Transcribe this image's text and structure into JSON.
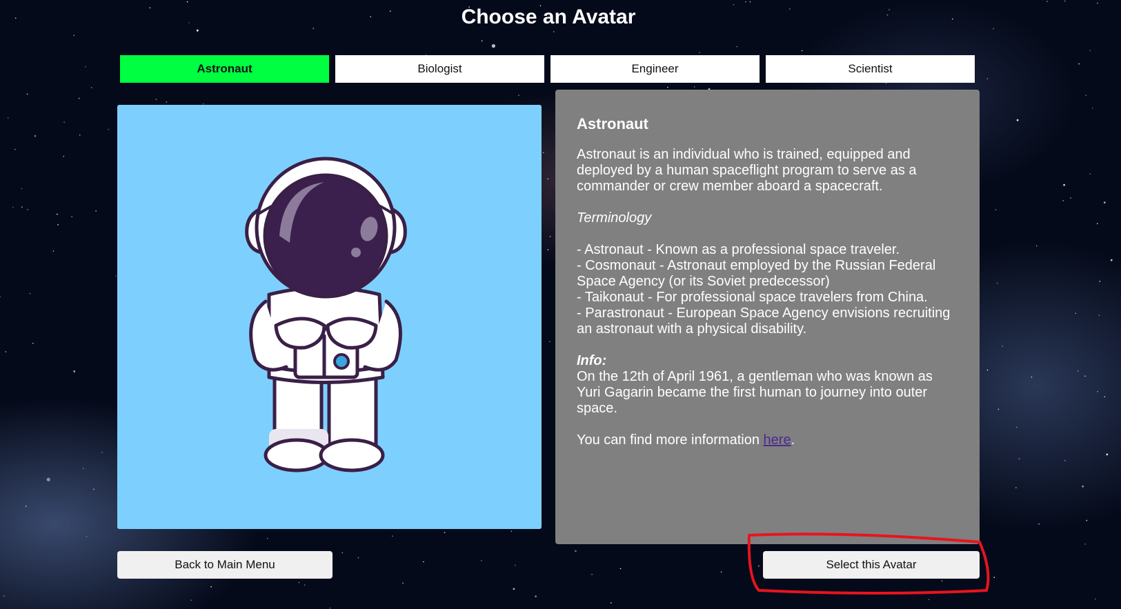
{
  "page": {
    "title": "Choose an Avatar"
  },
  "tabs": [
    {
      "label": "Astronaut",
      "active": true
    },
    {
      "label": "Biologist",
      "active": false
    },
    {
      "label": "Engineer",
      "active": false
    },
    {
      "label": "Scientist",
      "active": false
    }
  ],
  "avatar_image": {
    "subject": "cartoon astronaut",
    "background_color": "#7dd0fd"
  },
  "info": {
    "heading": "Astronaut",
    "intro": "Astronaut is an individual who is trained, equipped and deployed by a human spaceflight program to serve as a commander or crew member aboard a spacecraft.",
    "terminology_heading": "Terminology",
    "terms": [
      "- Astronaut - Known as a professional space traveler.",
      "- Cosmonaut - Astronaut employed by the Russian Federal Space Agency (or its Soviet predecessor)",
      "- Taikonaut - For professional space travelers from China.",
      "- Parastronaut - European Space Agency envisions recruiting an astronaut with a physical disability."
    ],
    "info_heading": "Info:",
    "info_text": "On the 12th of April 1961, a gentleman who was known as Yuri Gagarin became the first human to journey into outer space.",
    "more_prefix": "You can find more information ",
    "more_link": "here",
    "more_suffix": "."
  },
  "buttons": {
    "back": "Back to Main Menu",
    "select": "Select this Avatar"
  },
  "colors": {
    "active_tab": "#00ff41",
    "panel": "#808080",
    "link": "#4b2a8f",
    "annotation": "#e8141e"
  }
}
